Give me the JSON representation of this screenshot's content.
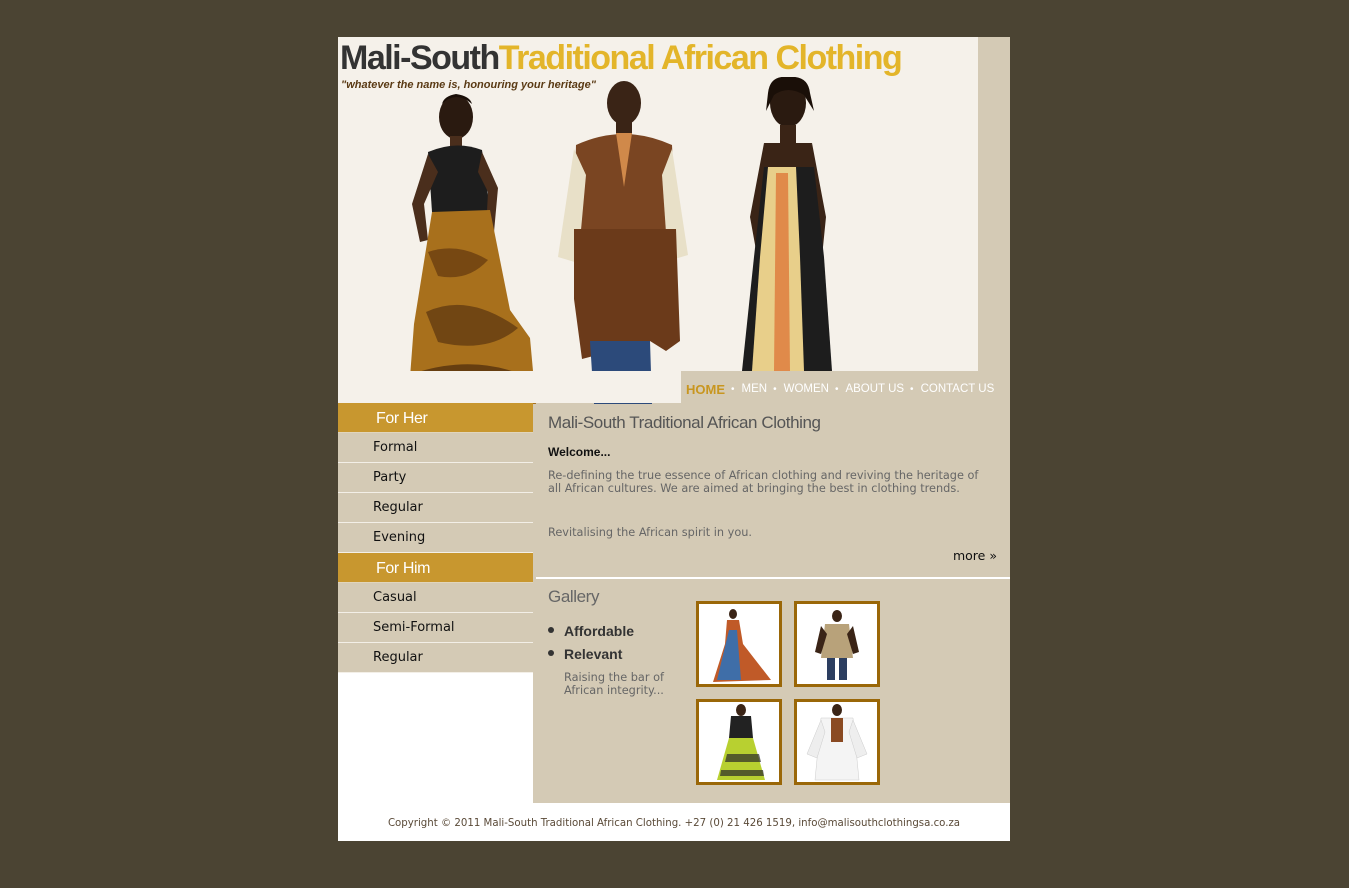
{
  "header": {
    "logo_part1": "Mali-South",
    "logo_part2": "Traditional African Clothing",
    "tagline": "\"whatever the name is, honouring your heritage\""
  },
  "nav": {
    "items": [
      {
        "label": "HOME",
        "active": true
      },
      {
        "label": "MEN"
      },
      {
        "label": "WOMEN"
      },
      {
        "label": "ABOUT US"
      },
      {
        "label": "CONTACT US"
      }
    ],
    "separator": "•"
  },
  "sidebar": {
    "her_heading": "For Her",
    "her_items": [
      "Formal",
      "Party",
      "Regular",
      "Evening"
    ],
    "him_heading": "For Him",
    "him_items": [
      "Casual",
      "Semi-Formal",
      "Regular"
    ]
  },
  "content": {
    "title": "Mali-South Traditional African Clothing",
    "welcome": "Welcome...",
    "intro": "Re-defining the true essence of African clothing and reviving the heritage of all African cultures. We are aimed at bringing the best in clothing trends.",
    "spirit": "Revitalising the African spirit in you.",
    "more": "more »"
  },
  "gallery": {
    "title": "Gallery",
    "bullets": [
      "Affordable",
      "Relevant"
    ],
    "raising": "Raising the bar of African integrity..."
  },
  "footer": {
    "copyright": "Copyright © 2011 Mali-South Traditional African Clothing. +27 (0) 21 426 1519, info@malisouthclothingsa.co.za"
  },
  "colors": {
    "page_bg": "#4b4433",
    "panel_bg": "#d4cab5",
    "accent_gold": "#c8972f",
    "logo_gold": "#e3b52a",
    "thumb_border": "#9a6708"
  }
}
